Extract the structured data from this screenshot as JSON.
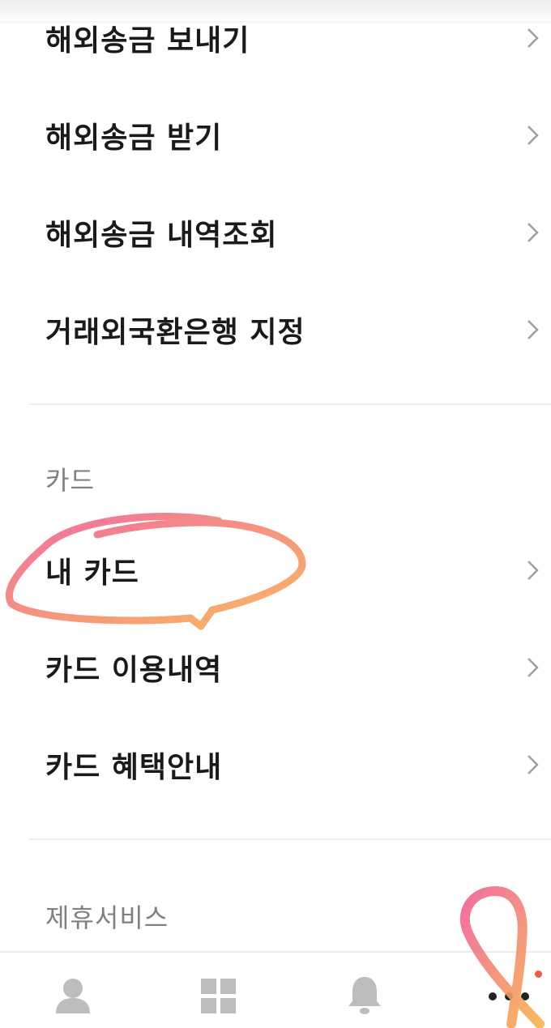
{
  "remittance": {
    "items": [
      {
        "label": "해외송금 보내기"
      },
      {
        "label": "해외송금 받기"
      },
      {
        "label": "해외송금 내역조회"
      },
      {
        "label": "거래외국환은행 지정"
      }
    ]
  },
  "card": {
    "title": "카드",
    "items": [
      {
        "label": "내 카드"
      },
      {
        "label": "카드 이용내역"
      },
      {
        "label": "카드 혜택안내"
      }
    ]
  },
  "partner": {
    "title": "제휴서비스"
  },
  "tabbar": {
    "tabs": [
      {
        "icon": "person-icon"
      },
      {
        "icon": "grid-icon"
      },
      {
        "icon": "bell-icon"
      },
      {
        "icon": "more-icon",
        "badge": true
      }
    ]
  },
  "colors": {
    "text": "#1a1a1a",
    "section": "#808080",
    "icon": "#bdbdbd",
    "badge": "#f05a4f",
    "highlight_start": "#ef5f95",
    "highlight_end": "#f8b24d"
  }
}
